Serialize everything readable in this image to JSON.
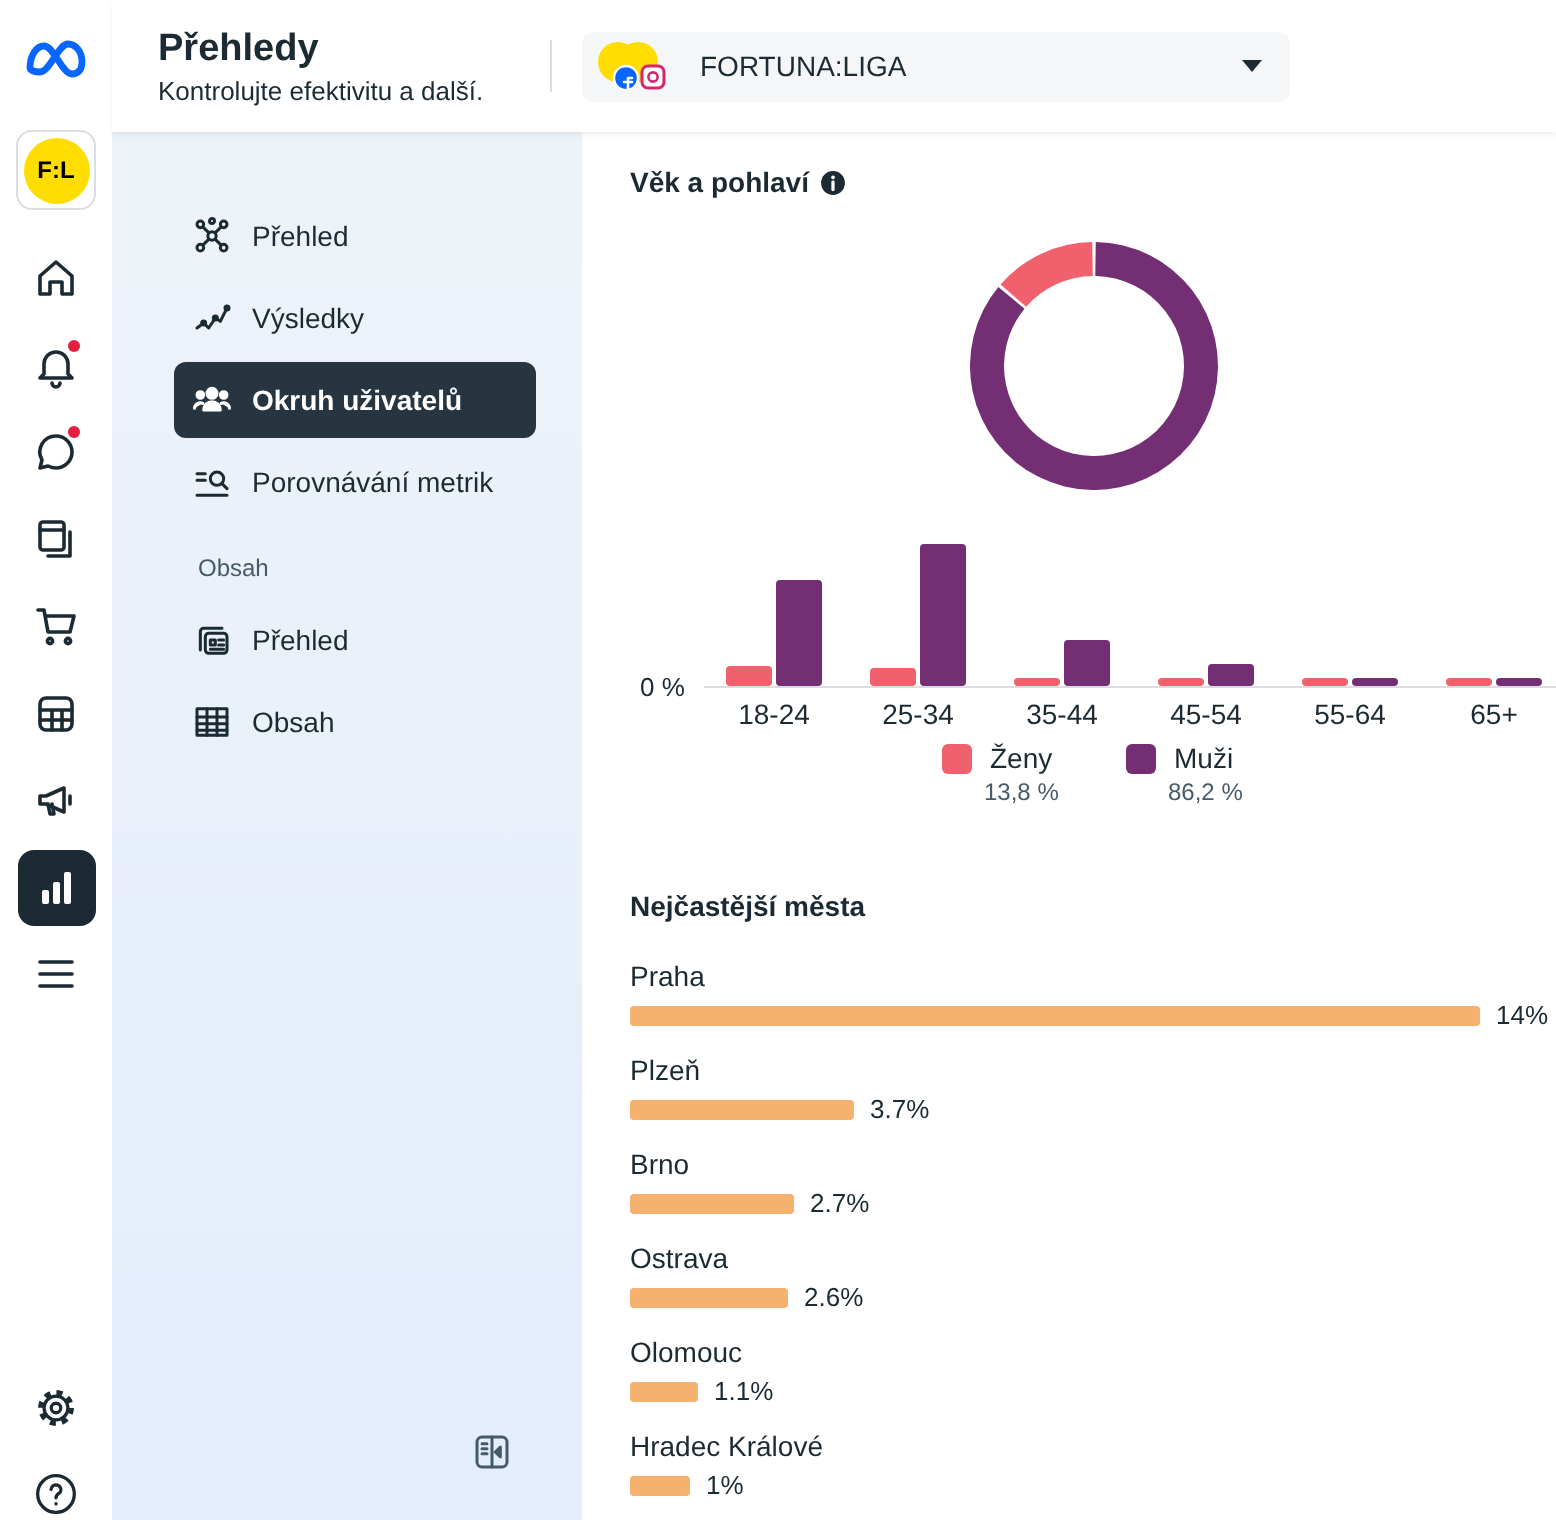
{
  "header": {
    "title": "Přehledy",
    "subtitle": "Kontrolujte efektivitu a další."
  },
  "account_selector": {
    "label": "FORTUNA:LIGA"
  },
  "rail": {
    "avatar": "F:L",
    "items": [
      {
        "selected": false,
        "badge": false
      },
      {
        "selected": false,
        "badge": true
      },
      {
        "selected": false,
        "badge": true
      },
      {
        "selected": false,
        "badge": false
      },
      {
        "selected": false,
        "badge": false
      },
      {
        "selected": false,
        "badge": false
      },
      {
        "selected": false,
        "badge": false
      },
      {
        "selected": true,
        "badge": false
      },
      {
        "selected": false,
        "badge": false
      }
    ]
  },
  "sidebar": {
    "sections": [
      {
        "items": [
          {
            "label": "Přehled",
            "selected": false
          },
          {
            "label": "Výsledky",
            "selected": false
          },
          {
            "label": "Okruh uživatelů",
            "selected": true
          },
          {
            "label": "Porovnávání metrik",
            "selected": false
          }
        ]
      },
      {
        "title": "Obsah",
        "items": [
          {
            "label": "Přehled",
            "selected": false
          },
          {
            "label": "Obsah",
            "selected": false
          }
        ]
      }
    ]
  },
  "age_gender": {
    "title": "Věk a pohlaví",
    "chart_data": {
      "type": "donut",
      "categories": [
        "Ženy",
        "Muži"
      ],
      "values": [
        13.8,
        86.2
      ]
    },
    "bar_axis_label": "0 %",
    "age_groups": [
      "18-24",
      "25-34",
      "35-44",
      "45-54",
      "55-64",
      "65+"
    ],
    "legend": [
      {
        "value": "13,8 %",
        "color": "#f0616d"
      },
      {
        "value": "86,2 %",
        "color": "#742f74"
      }
    ]
  },
  "cities": {
    "title": "Nejčastější města",
    "items": [
      {
        "name": "Praha",
        "value": "14%"
      },
      {
        "name": "Plzeň",
        "value": "3.7%"
      },
      {
        "name": "Brno",
        "value": "2.7%"
      },
      {
        "name": "Ostrava",
        "value": "2.6%"
      },
      {
        "name": "Olomouc",
        "value": "1.1%"
      },
      {
        "name": "Hradec Králové",
        "value": "1%"
      }
    ]
  }
}
